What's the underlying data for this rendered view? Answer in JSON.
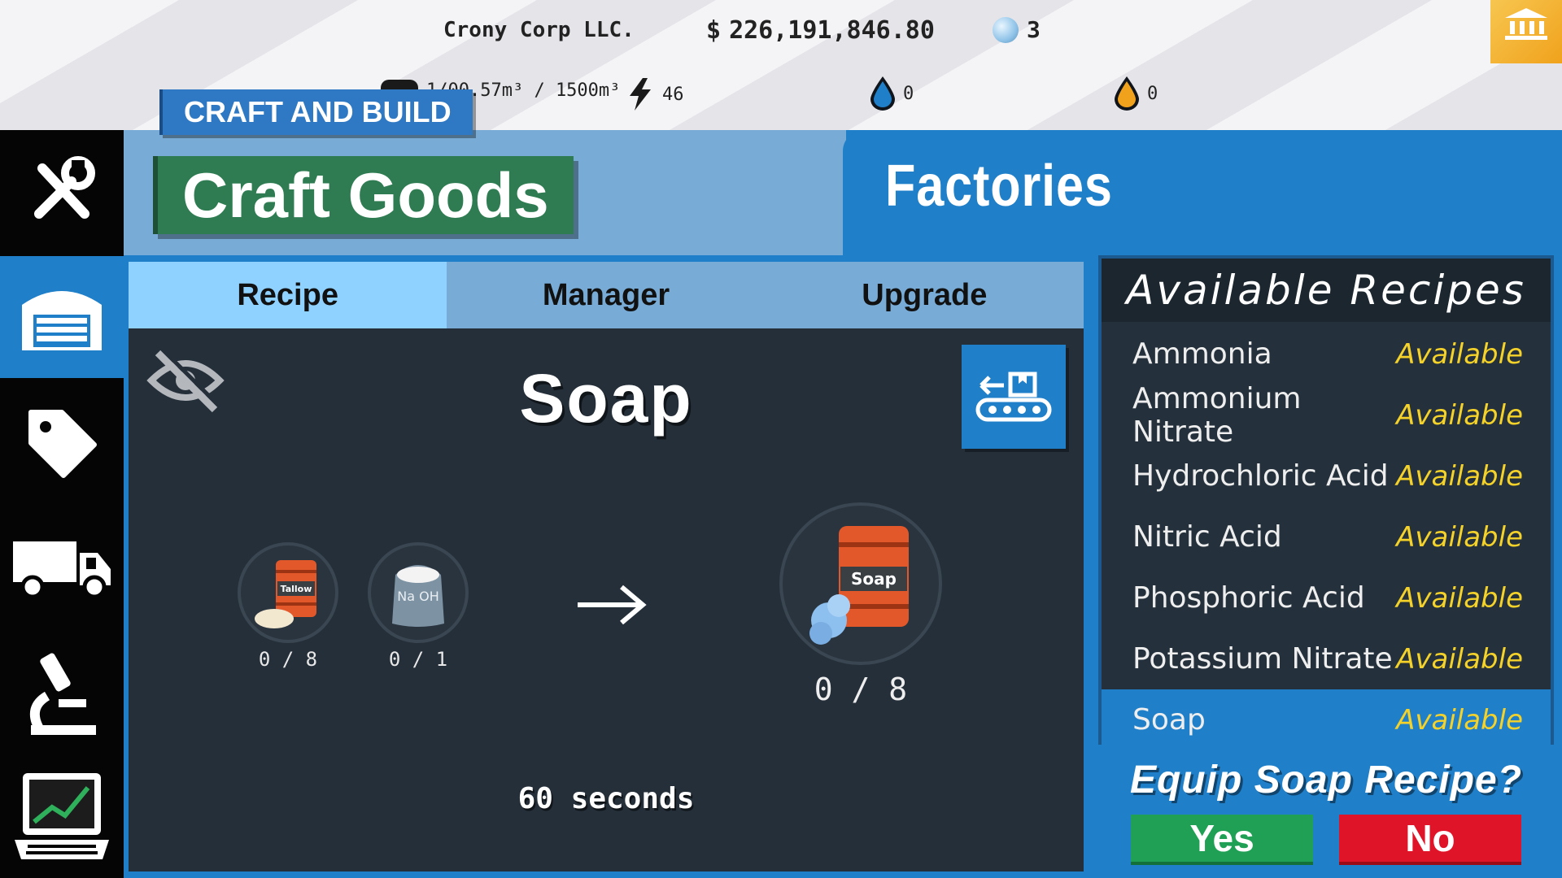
{
  "topbar": {
    "company": "Crony Corp LLC.",
    "money": "226,191,846.80",
    "gems": "3",
    "storage": "1/00.57m³ / 1500m³",
    "energy": "46",
    "water": "0",
    "oil": "0"
  },
  "sidenav": {
    "items": [
      {
        "icon": "tools-icon",
        "label": ""
      },
      {
        "icon": "warehouse-icon",
        "label": ""
      },
      {
        "icon": "price-tag-icon",
        "label": ""
      },
      {
        "icon": "truck-icon",
        "label": ""
      },
      {
        "icon": "microscope-icon",
        "label": ""
      },
      {
        "icon": "laptop-chart-icon",
        "label": ""
      }
    ]
  },
  "header": {
    "section_badge": "CRAFT AND BUILD",
    "page_title": "Craft Goods",
    "panel_title": "Factories"
  },
  "tabs": [
    "Recipe",
    "Manager",
    "Upgrade"
  ],
  "recipe": {
    "name": "Soap",
    "ingredients": [
      {
        "name": "Tallow",
        "label": "Tallow",
        "qty": "0 / 8"
      },
      {
        "name": "NaOH",
        "label": "Na OH",
        "qty": "0 / 1"
      }
    ],
    "product": {
      "name": "Soap",
      "label": "Soap",
      "qty": "0 / 8"
    },
    "duration": "60 seconds"
  },
  "available_recipes": {
    "title": "Available Recipes",
    "items": [
      {
        "name": "Ammonia",
        "status": "Available"
      },
      {
        "name": "Ammonium Nitrate",
        "status": "Available"
      },
      {
        "name": "Hydrochloric Acid",
        "status": "Available"
      },
      {
        "name": "Nitric Acid",
        "status": "Available"
      },
      {
        "name": "Phosphoric Acid",
        "status": "Available"
      },
      {
        "name": "Potassium Nitrate",
        "status": "Available"
      },
      {
        "name": "Soap",
        "status": "Available",
        "selected": true
      }
    ]
  },
  "confirm": {
    "question": "Equip Soap Recipe?",
    "yes": "Yes",
    "no": "No"
  },
  "colors": {
    "accent_blue": "#1f7fc8",
    "light_blue": "#78acd6",
    "active_tab": "#8fd2ff",
    "panel_dark": "#252f3a",
    "craft_goods_green": "#2f7c52",
    "available_yellow": "#f4d22a",
    "yes_green": "#1fa055",
    "no_red": "#e01428"
  }
}
